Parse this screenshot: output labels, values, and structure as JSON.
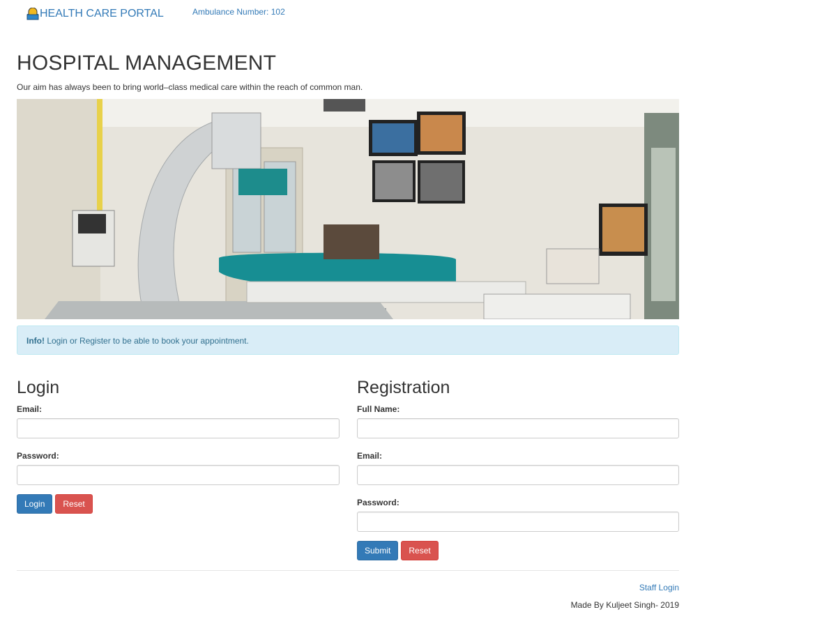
{
  "nav": {
    "brand": "HEALTH CARE PORTAL",
    "ambulance": "Ambulance Number: 102"
  },
  "header": {
    "title": "HOSPITAL MANAGEMENT",
    "tagline": "Our aim has always been to bring world–class medical care within the reach of common man."
  },
  "alert": {
    "strong": "Info!",
    "text": " Login or Register to be able to book your appointment."
  },
  "login": {
    "heading": "Login",
    "email_label": "Email:",
    "email_value": "",
    "password_label": "Password:",
    "password_value": "",
    "submit_label": "Login",
    "reset_label": "Reset"
  },
  "register": {
    "heading": "Registration",
    "name_label": "Full Name:",
    "name_value": "",
    "email_label": "Email:",
    "email_value": "",
    "password_label": "Password:",
    "password_value": "",
    "submit_label": "Submit",
    "reset_label": "Reset"
  },
  "footer": {
    "staff_login": "Staff Login",
    "credit": "Made By Kuljeet Singh- 2019"
  },
  "colors": {
    "link": "#337ab7",
    "primary": "#337ab7",
    "danger": "#d9534f",
    "info_bg": "#d9edf7",
    "info_text": "#31708f"
  },
  "icons": {
    "brand": "hospital-logo-icon"
  }
}
